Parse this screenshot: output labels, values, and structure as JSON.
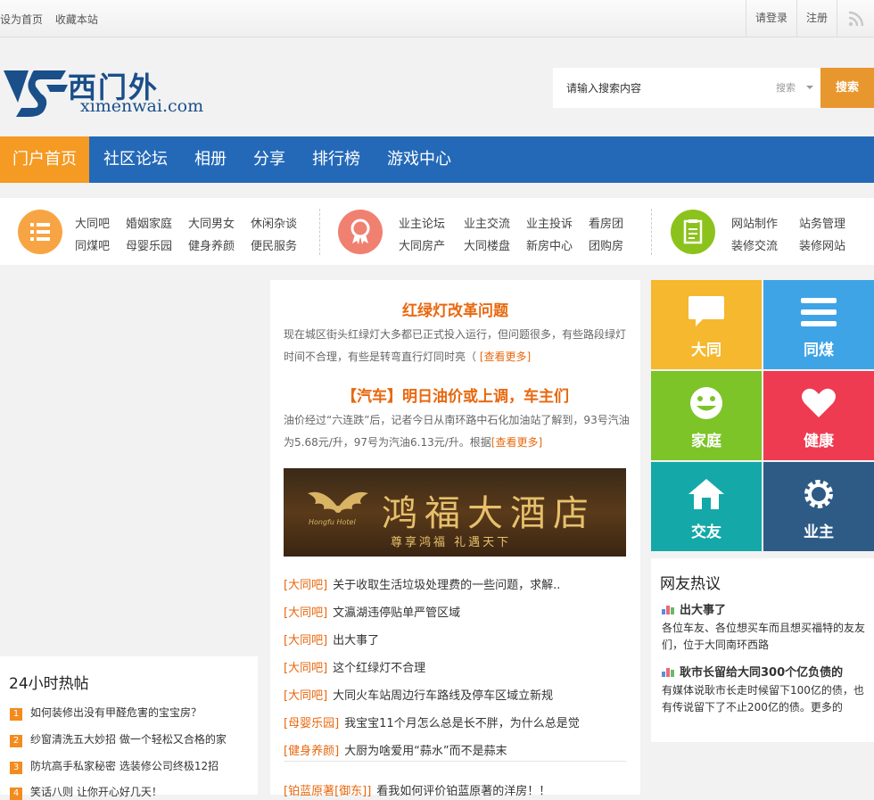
{
  "topbar": {
    "set_home": "设为首页",
    "bookmark": "收藏本站",
    "login": "请登录",
    "register": "注册"
  },
  "logo": {
    "cn": "西门外",
    "en": "ximenwai.com"
  },
  "search": {
    "placeholder": "请输入搜索内容",
    "scope": "搜索",
    "button": "搜索"
  },
  "nav": [
    "门户首页",
    "社区论坛",
    "相册",
    "分享",
    "排行榜",
    "游戏中心"
  ],
  "categories": [
    {
      "icon": "list-icon",
      "color": "#f7a544",
      "links": [
        "大同吧",
        "婚姻家庭",
        "大同男女",
        "休闲杂谈",
        "同煤吧",
        "母婴乐园",
        "健身养颜",
        "便民服务"
      ]
    },
    {
      "icon": "award-icon",
      "color": "#f08070",
      "links": [
        "业主论坛",
        "业主交流",
        "业主投诉",
        "看房团",
        "大同房产",
        "大同楼盘",
        "新房中心",
        "团购房"
      ]
    },
    {
      "icon": "document-icon",
      "color": "#8cc21c",
      "links": [
        "网站制作",
        "站务管理",
        "装修交流",
        "装修网站"
      ]
    }
  ],
  "hot24": {
    "title": "24小时热帖",
    "items": [
      {
        "num": "1",
        "text": "如何装修出没有甲醛危害的宝宝房？"
      },
      {
        "num": "2",
        "text": "纱窗清洗五大妙招 做一个轻松又合格的家"
      },
      {
        "num": "3",
        "text": "防坑高手私家秘密 选装修公司终极12招"
      },
      {
        "num": "4",
        "text": "笑话八则 让你开心好几天！"
      }
    ]
  },
  "center": {
    "headline1": "红绿灯改革问题",
    "summary1": "现在城区街头红绿灯大多都已正式投入运行，但问题很多，有些路段绿灯时间不合理，有些是转弯直行灯同时亮（",
    "more1": "[查看更多]",
    "headline2": "【汽车】明日油价或上调，车主们",
    "summary2": "油价经过“六连跌”后，记者今日从南环路中石化加油站了解到，93号汽油为5.68元/升，97号为汽油6.13元/升。根据",
    "more2": "[查看更多]",
    "ad": {
      "name": "鸿福大酒店",
      "slogan": "尊享鸿福 礼遇天下",
      "brand": "Hongfu Hotel"
    },
    "posts": [
      {
        "tag": "[大同吧]",
        "text": "关于收取生活垃圾处理费的一些问题，求解.."
      },
      {
        "tag": "[大同吧]",
        "text": "文瀛湖违停贴单严管区域"
      },
      {
        "tag": "[大同吧]",
        "text": "出大事了"
      },
      {
        "tag": "[大同吧]",
        "text": "这个红绿灯不合理"
      },
      {
        "tag": "[大同吧]",
        "text": "大同火车站周边行车路线及停车区域立新规"
      },
      {
        "tag": "[母婴乐园]",
        "text": "我宝宝11个月怎么总是长不胖，为什么总是觉"
      },
      {
        "tag": "[健身养颜]",
        "text": "大厨为啥爱用“蒜水”而不是蒜末"
      },
      {
        "tag": "[铂蓝原著[御东]]",
        "text": "看我如何评价铂蓝原著的洋房！！"
      }
    ]
  },
  "tiles": [
    {
      "label": "大同",
      "icon": "chat-bubble-icon",
      "color": "#f5b82e"
    },
    {
      "label": "同煤",
      "icon": "menu-lines-icon",
      "color": "#3ea4e6"
    },
    {
      "label": "家庭",
      "icon": "smiley-icon",
      "color": "#7cc428"
    },
    {
      "label": "健康",
      "icon": "heart-icon",
      "color": "#ee3b52"
    },
    {
      "label": "交友",
      "icon": "home-icon",
      "color": "#14a8a8"
    },
    {
      "label": "业主",
      "icon": "gear-icon",
      "color": "#2e5b86"
    }
  ],
  "netizen": {
    "title": "网友热议",
    "items": [
      {
        "title": "出大事了",
        "desc": "各位车友、各位想买车而且想买福特的友友们，位于大同南环西路"
      },
      {
        "title": "耿市长留给大同300个亿负债的",
        "desc": "有媒体说耿市长走时候留下100亿的债，也有传说留下了不止200亿的债。更多的"
      }
    ]
  }
}
